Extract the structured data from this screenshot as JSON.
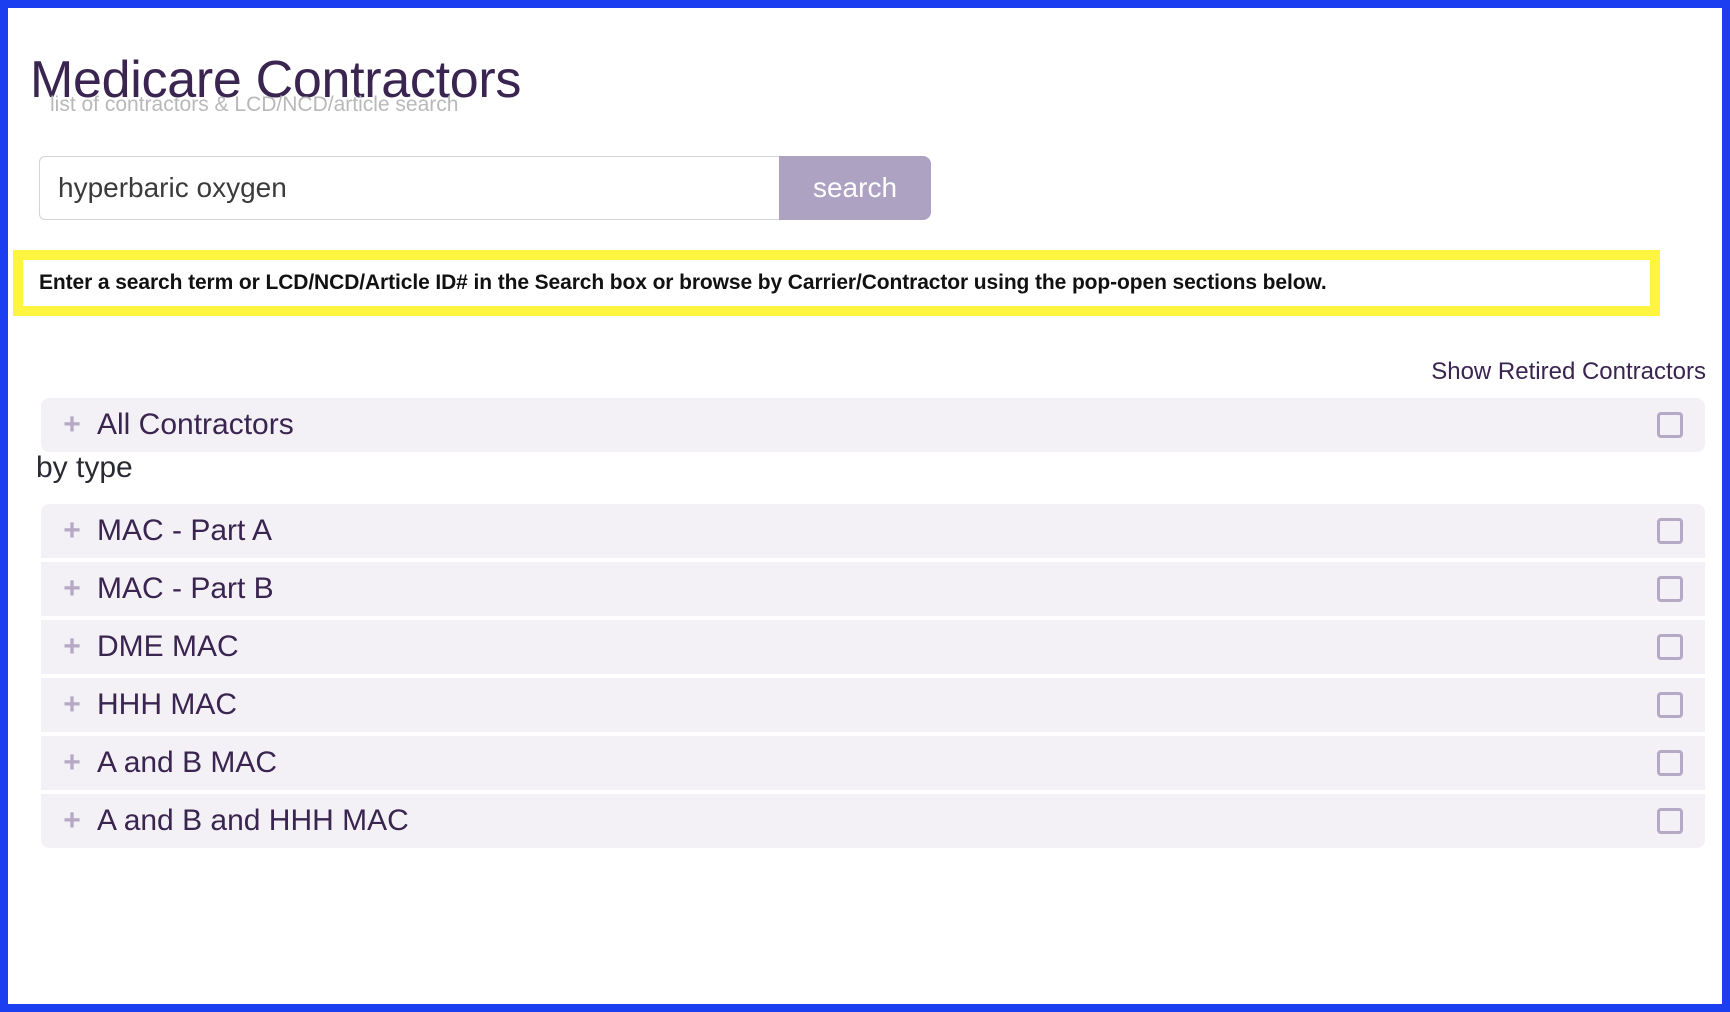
{
  "header": {
    "title": "Medicare Contractors",
    "subtitle": "list of contractors & LCD/NCD/article search"
  },
  "search": {
    "value": "hyperbaric oxygen",
    "placeholder": "",
    "button_label": "search"
  },
  "alert": {
    "text": "Enter a search term or LCD/NCD/Article ID# in the Search box or browse by Carrier/Contractor using the pop-open sections below.",
    "background_color": "#fff540"
  },
  "toolbar": {
    "show_retired_label": "Show Retired Contractors"
  },
  "all_contractors": {
    "label": "All Contractors",
    "expand_icon": "+",
    "checked": false
  },
  "by_type": {
    "heading": "by type",
    "items": [
      {
        "label": "MAC - Part A",
        "expand_icon": "+",
        "checked": false
      },
      {
        "label": "MAC - Part B",
        "expand_icon": "+",
        "checked": false
      },
      {
        "label": "DME MAC",
        "expand_icon": "+",
        "checked": false
      },
      {
        "label": "HHH MAC",
        "expand_icon": "+",
        "checked": false
      },
      {
        "label": "A and B MAC",
        "expand_icon": "+",
        "checked": false
      },
      {
        "label": "A and B and HHH MAC",
        "expand_icon": "+",
        "checked": false
      }
    ]
  },
  "colors": {
    "frame_blue": "#1a3ef0",
    "accent_purple": "#3a2450",
    "mauve": "#ada2c1",
    "row_bg": "#f3f1f5",
    "alert_yellow": "#fff540"
  }
}
